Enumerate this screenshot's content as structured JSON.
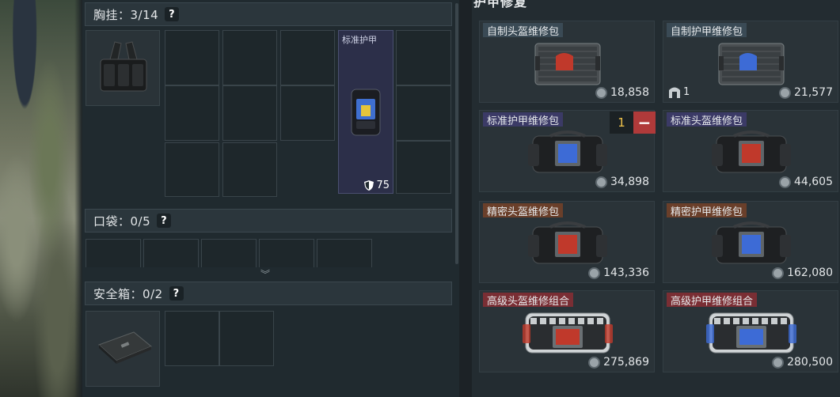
{
  "chest_rig": {
    "title": "胸挂：3/14",
    "help": "?"
  },
  "armor": {
    "label": "标准护甲",
    "durability": "75"
  },
  "pocket": {
    "title": "口袋：0/5",
    "help": "?"
  },
  "safebox": {
    "title": "安全箱：0/2",
    "help": "?"
  },
  "repair_panel": {
    "title": "护甲修复"
  },
  "quantity": {
    "value": "1",
    "minus": "−"
  },
  "kits": [
    {
      "name": "自制头盔维修包",
      "price": "18,858",
      "type": "case",
      "accent": "#c0392b",
      "title_bg": "#3a4a55"
    },
    {
      "name": "自制护甲维修包",
      "price": "21,577",
      "owned": "1",
      "type": "case",
      "accent": "#3d6bd6",
      "title_bg": "#3a4a55"
    },
    {
      "name": "标准护甲维修包",
      "price": "34,898",
      "type": "bag",
      "accent": "#3d6bd6",
      "title_bg": "#3b3a66"
    },
    {
      "name": "标准头盔维修包",
      "price": "44,605",
      "type": "bag",
      "accent": "#c0392b",
      "title_bg": "#3b3a66"
    },
    {
      "name": "精密头盔维修包",
      "price": "143,336",
      "type": "bag",
      "accent": "#c0392b",
      "title_bg": "#6a3f2a"
    },
    {
      "name": "精密护甲维修包",
      "price": "162,080",
      "type": "bag",
      "accent": "#3d6bd6",
      "title_bg": "#6a3f2a"
    },
    {
      "name": "高级头盔维修组合",
      "price": "275,869",
      "type": "bigbag",
      "accent": "#c0392b",
      "title_bg": "#7a2e34"
    },
    {
      "name": "高级护甲维修组合",
      "price": "280,500",
      "type": "bigbag",
      "accent": "#3d6bd6",
      "title_bg": "#7a2e34"
    }
  ]
}
